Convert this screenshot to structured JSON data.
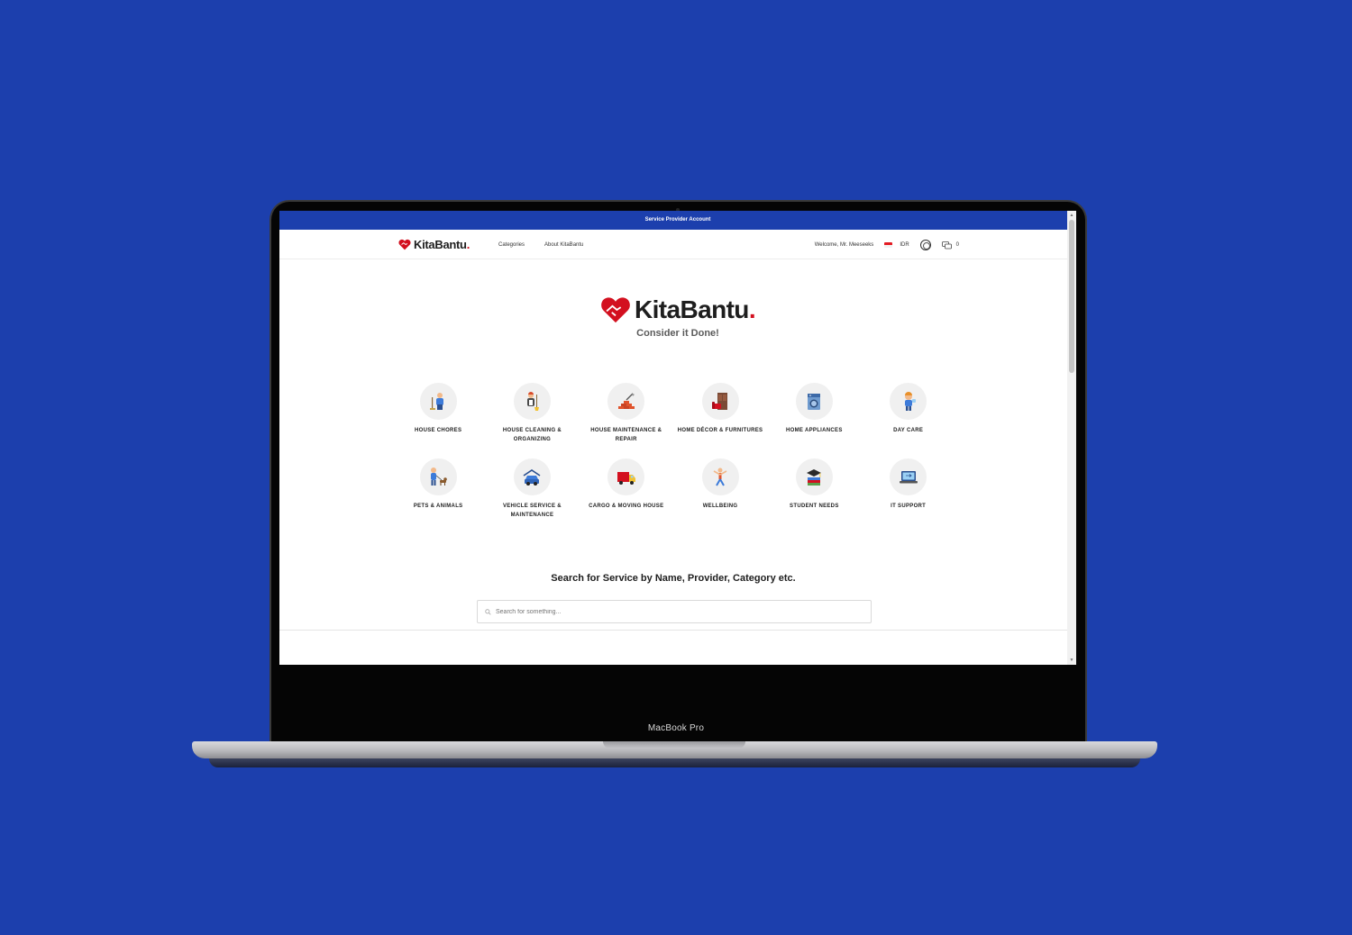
{
  "device": {
    "model_label": "MacBook Pro"
  },
  "topbar": {
    "text": "Service Provider Account"
  },
  "nav": {
    "brand": "KitaBantu",
    "brand_dot": ".",
    "links": [
      "Categories",
      "About KitaBantu"
    ],
    "welcome": "Welcome, Mr. Meeseeks",
    "currency": "IDR",
    "chat_count": "0"
  },
  "hero": {
    "brand": "KitaBantu",
    "brand_dot": ".",
    "tagline": "Consider it Done!"
  },
  "categories": [
    {
      "label": "HOUSE CHORES",
      "icon": "house-chores-icon"
    },
    {
      "label": "HOUSE CLEANING & ORGANIZING",
      "icon": "house-cleaning-icon"
    },
    {
      "label": "HOUSE MAINTENANCE & REPAIR",
      "icon": "house-maintenance-icon"
    },
    {
      "label": "HOME DÉCOR & FURNITURES",
      "icon": "home-decor-icon"
    },
    {
      "label": "HOME APPLIANCES",
      "icon": "home-appliances-icon"
    },
    {
      "label": "DAY CARE",
      "icon": "day-care-icon"
    },
    {
      "label": "PETS & ANIMALS",
      "icon": "pets-animals-icon"
    },
    {
      "label": "VEHICLE SERVICE & MAINTENANCE",
      "icon": "vehicle-service-icon"
    },
    {
      "label": "CARGO & MOVING HOUSE",
      "icon": "cargo-moving-icon"
    },
    {
      "label": "WELLBEING",
      "icon": "wellbeing-icon"
    },
    {
      "label": "STUDENT NEEDS",
      "icon": "student-needs-icon"
    },
    {
      "label": "IT SUPPORT",
      "icon": "it-support-icon"
    }
  ],
  "search": {
    "title": "Search for Service by Name, Provider, Category etc.",
    "placeholder": "Search for something..."
  },
  "colors": {
    "background": "#1c3fad",
    "accent": "#1c3fad",
    "brand_red": "#d3101f"
  }
}
